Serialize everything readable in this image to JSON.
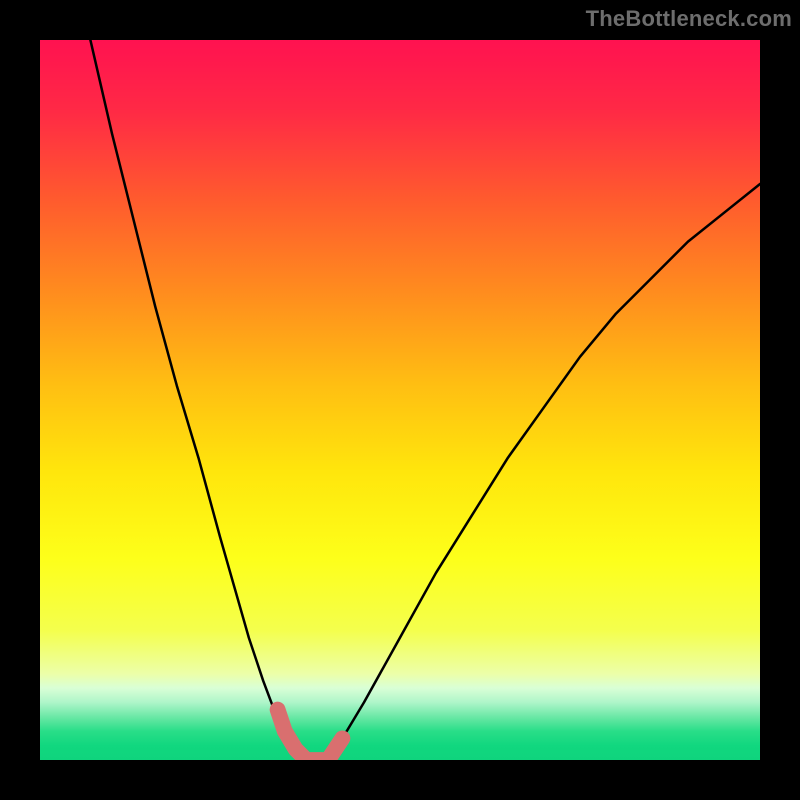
{
  "watermark": "TheBottleneck.com",
  "chart_data": {
    "type": "line",
    "title": "",
    "xlabel": "",
    "ylabel": "",
    "xlim": [
      0,
      100
    ],
    "ylim": [
      0,
      100
    ],
    "series": [
      {
        "name": "left-curve",
        "x": [
          7,
          10,
          13,
          16,
          19,
          22,
          25,
          27,
          29,
          31,
          32.5,
          34,
          35.5,
          37
        ],
        "values": [
          100,
          87,
          75,
          63,
          52,
          42,
          31,
          24,
          17,
          11,
          7,
          4,
          2,
          0
        ]
      },
      {
        "name": "right-curve",
        "x": [
          40,
          42,
          45,
          50,
          55,
          60,
          65,
          70,
          75,
          80,
          85,
          90,
          95,
          100
        ],
        "values": [
          0,
          3,
          8,
          17,
          26,
          34,
          42,
          49,
          56,
          62,
          67,
          72,
          76,
          80
        ]
      },
      {
        "name": "highlight-segment",
        "x": [
          33,
          34,
          35.5,
          37,
          38.5,
          40,
          41,
          42
        ],
        "values": [
          7,
          4,
          1.5,
          0,
          0,
          0,
          1.5,
          3
        ]
      }
    ],
    "background_gradient": {
      "stops": [
        {
          "offset": 0.0,
          "color": "#ff1250"
        },
        {
          "offset": 0.1,
          "color": "#ff2a45"
        },
        {
          "offset": 0.22,
          "color": "#ff5a2e"
        },
        {
          "offset": 0.35,
          "color": "#ff8c1e"
        },
        {
          "offset": 0.48,
          "color": "#ffbf12"
        },
        {
          "offset": 0.6,
          "color": "#ffe60c"
        },
        {
          "offset": 0.72,
          "color": "#fdff1a"
        },
        {
          "offset": 0.82,
          "color": "#f4ff4d"
        },
        {
          "offset": 0.88,
          "color": "#ecffa8"
        },
        {
          "offset": 0.9,
          "color": "#d9ffd6"
        },
        {
          "offset": 0.92,
          "color": "#aef5c9"
        },
        {
          "offset": 0.94,
          "color": "#6be8a6"
        },
        {
          "offset": 0.96,
          "color": "#29de88"
        },
        {
          "offset": 0.98,
          "color": "#11d77f"
        },
        {
          "offset": 1.0,
          "color": "#0fd47d"
        }
      ]
    },
    "highlight_color": "#d96f6f",
    "curve_color": "#000000"
  }
}
